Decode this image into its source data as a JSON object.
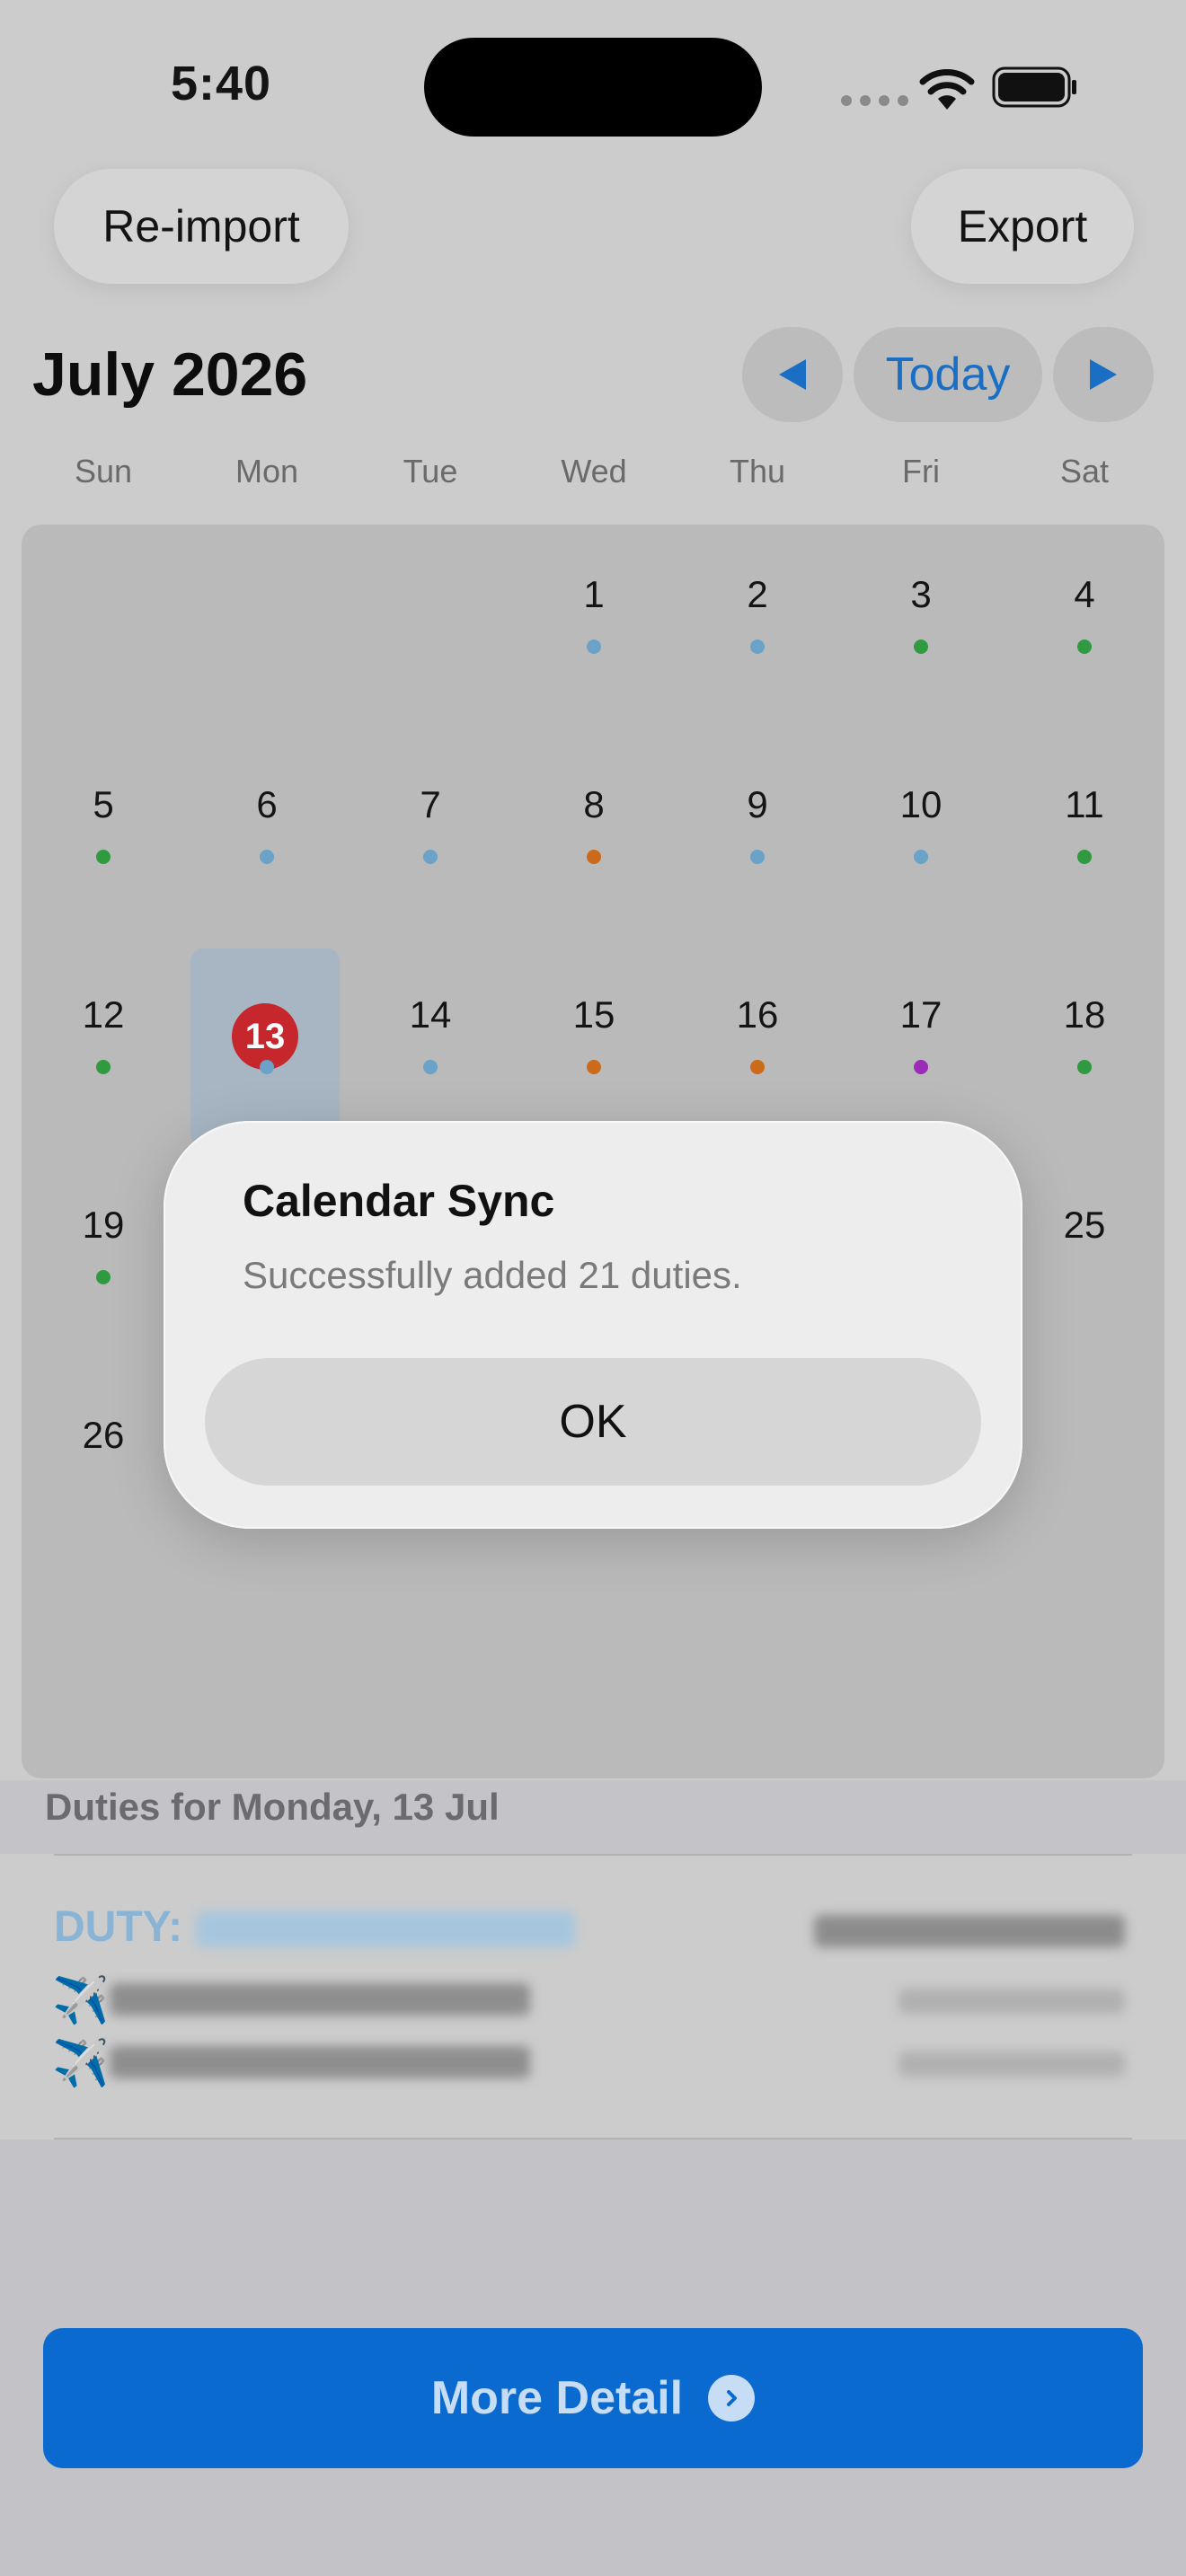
{
  "status_bar": {
    "time": "5:40"
  },
  "toolbar": {
    "reimport_label": "Re-import",
    "export_label": "Export"
  },
  "calendar": {
    "month_title": "July 2026",
    "today_label": "Today",
    "weekdays": [
      "Sun",
      "Mon",
      "Tue",
      "Wed",
      "Thu",
      "Fri",
      "Sat"
    ],
    "days": [
      {
        "d": "1",
        "dot": "blue"
      },
      {
        "d": "2",
        "dot": "blue"
      },
      {
        "d": "3",
        "dot": "green"
      },
      {
        "d": "4",
        "dot": "green"
      },
      {
        "d": "5",
        "dot": "green"
      },
      {
        "d": "6",
        "dot": "blue"
      },
      {
        "d": "7",
        "dot": "blue"
      },
      {
        "d": "8",
        "dot": "orange"
      },
      {
        "d": "9",
        "dot": "blue"
      },
      {
        "d": "10",
        "dot": "blue"
      },
      {
        "d": "11",
        "dot": "green"
      },
      {
        "d": "12",
        "dot": "green"
      },
      {
        "d": "13",
        "dot": "blue"
      },
      {
        "d": "14",
        "dot": "blue"
      },
      {
        "d": "15",
        "dot": "orange"
      },
      {
        "d": "16",
        "dot": "orange"
      },
      {
        "d": "17",
        "dot": "purple"
      },
      {
        "d": "18",
        "dot": "green"
      },
      {
        "d": "19",
        "dot": "green"
      },
      {
        "d": "25",
        "dot": ""
      },
      {
        "d": "26",
        "dot": ""
      }
    ],
    "selected_day": "13",
    "dot_colors": {
      "blue": "#6aa2c8",
      "green": "#2f9a3f",
      "orange": "#cc6a1c",
      "purple": "#9a2cb8"
    }
  },
  "duties": {
    "header": "Duties for Monday, 13 Jul",
    "duty_label": "DUTY:"
  },
  "more_detail_label": "More Detail",
  "alert": {
    "title": "Calendar Sync",
    "message": "Successfully added 21 duties.",
    "ok_label": "OK"
  },
  "colors": {
    "accent": "#0a6ad0",
    "today_red": "#c5272c"
  }
}
